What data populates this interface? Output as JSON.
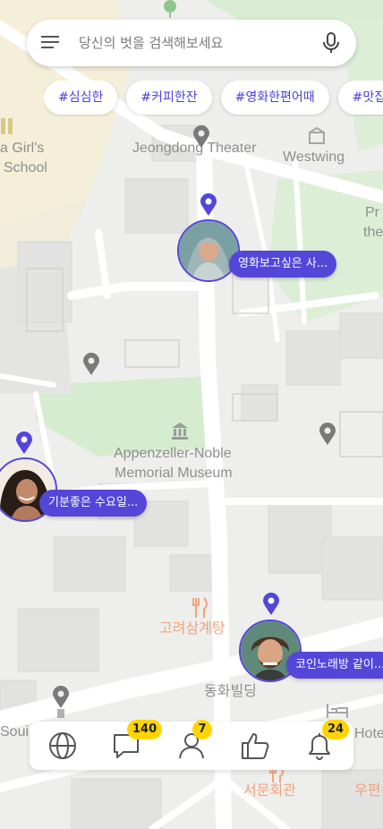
{
  "search": {
    "placeholder": "당신의 벗을 검색해보세요"
  },
  "tags": [
    "#심심한",
    "#커피한잔",
    "#영화한편어때",
    "#맛집탐"
  ],
  "map_labels": {
    "theater": "Jeongdong Theater",
    "westwing": "Westwing",
    "school_line1": "a Girl's",
    "school_line2": "School",
    "museum_line1": "Appenzeller-Noble",
    "museum_line2": "Memorial Museum",
    "restaurant": "고려삼계탕",
    "building": "동화빌딩",
    "hall": "서문회관",
    "right_edge_1": "Pr",
    "right_edge_2": "the",
    "hotel": "Hote",
    "left_bottom": "Soui",
    "right_bottom": "우편"
  },
  "users": [
    {
      "status": "영화보고싶은 사..."
    },
    {
      "status": "기분좋은 수요일..."
    },
    {
      "status": "코인노래방 같이..."
    }
  ],
  "nav": {
    "chat_badge": "140",
    "friends_badge": "7",
    "alerts_badge": "24"
  },
  "colors": {
    "accent": "#5346d9",
    "badge": "#ffd400",
    "tag_text": "#4a3fd6"
  }
}
